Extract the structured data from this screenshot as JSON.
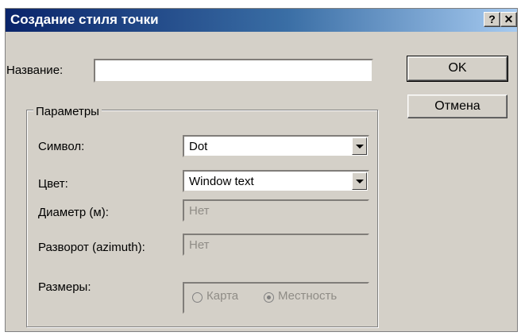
{
  "window": {
    "title": "Создание стиля точки",
    "help_label": "?",
    "close_label": "✕"
  },
  "name_field": {
    "label": "Название:",
    "value": ""
  },
  "buttons": {
    "ok": "OK",
    "cancel": "Отмена"
  },
  "params": {
    "legend": "Параметры",
    "symbol": {
      "label": "Символ:",
      "value": "Dot"
    },
    "color": {
      "label": "Цвет:",
      "value": "Window text"
    },
    "diameter": {
      "label": "Диаметр (м):",
      "value": "Нет"
    },
    "rotation": {
      "label": "Разворот (azimuth):",
      "value": "Нет"
    },
    "sizes": {
      "label": "Размеры:",
      "options": [
        "Карта",
        "Местность"
      ],
      "selected": "Местность"
    }
  }
}
